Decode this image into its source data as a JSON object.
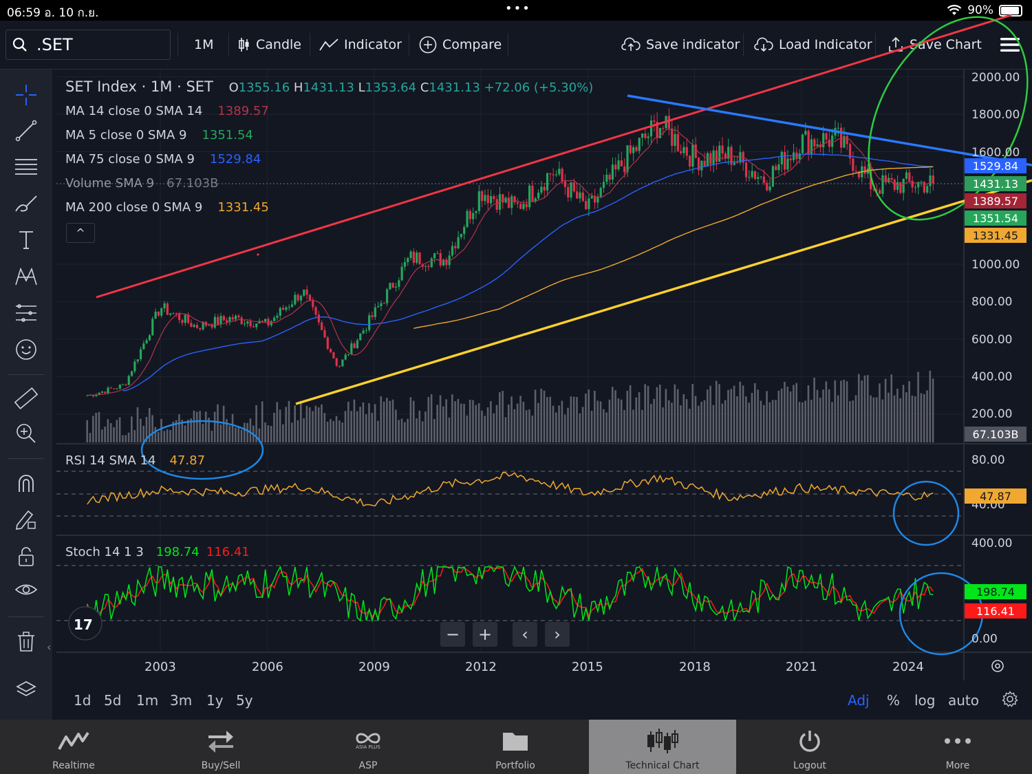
{
  "status": {
    "time": "06:59",
    "date": "อ. 10 ก.ย.",
    "dots": "•••",
    "battery": "90%"
  },
  "toolbar": {
    "symbol": ".SET",
    "interval": "1M",
    "candle": "Candle",
    "indicator": "Indicator",
    "compare": "Compare",
    "save_indicator": "Save indicator",
    "load_indicator": "Load Indicator",
    "save_chart": "Save Chart"
  },
  "legend": {
    "title": "SET Index · 1M · SET",
    "o_label": "O",
    "o": "1355.16",
    "h_label": "H",
    "h": "1431.13",
    "l_label": "L",
    "l": "1353.64",
    "c_label": "C",
    "c": "1431.13",
    "chg": "+72.06 (+5.30%)",
    "ma14_label": "MA 14 close 0 SMA 14",
    "ma14": "1389.57",
    "ma5_label": "MA 5 close 0 SMA 9",
    "ma5": "1351.54",
    "ma75_label": "MA 75 close 0 SMA 9",
    "ma75": "1529.84",
    "vol_label": "Volume SMA 9",
    "vol": "67.103B",
    "ma200_label": "MA 200 close 0 SMA 9",
    "ma200": "1331.45",
    "collapse": "^"
  },
  "rsi": {
    "label": "RSI 14 SMA 14",
    "value": "47.87",
    "axis": [
      "80.00",
      "40.00"
    ]
  },
  "stoch": {
    "label": "Stoch 14 1 3",
    "k": "198.74",
    "d": "116.41",
    "axis": [
      "400.00",
      "0.00"
    ]
  },
  "price_axis": [
    "2000.00",
    "1800.00",
    "1600.00",
    "1000.00",
    "800.00",
    "600.00",
    "400.00",
    "200.00"
  ],
  "price_tags": {
    "ma75": "1529.84",
    "close": "1431.13",
    "ma14": "1389.57",
    "ma5": "1351.54",
    "ma200": "1331.45",
    "vol": "67.103B"
  },
  "x_axis": [
    "2003",
    "2006",
    "2009",
    "2012",
    "2015",
    "2018",
    "2021",
    "2024"
  ],
  "nav": {
    "zoom_out": "−",
    "zoom_in": "+",
    "prev": "‹",
    "next": "›"
  },
  "ranges": [
    "1d",
    "5d",
    "1m",
    "3m",
    "1y",
    "5y"
  ],
  "range_opts": {
    "adj": "Adj",
    "pct": "%",
    "log": "log",
    "auto": "auto"
  },
  "tabs": [
    "Realtime",
    "Buy/Sell",
    "ASP",
    "Portfolio",
    "Technical Chart",
    "Logout",
    "More"
  ],
  "asp_logo": "ASIA PLUS",
  "colors": {
    "ma14": "#b2344a",
    "ma5": "#26a65b",
    "ma75": "#2962ff",
    "ma200": "#f0a830",
    "close_tag": "#2e9c5a",
    "ma14_tag": "#a32536",
    "rsi": "#f0a830",
    "stoch_k": "#00e61a",
    "stoch_d": "#ff1a1a"
  },
  "chart_data": [
    {
      "type": "line",
      "title": "SET Index · 1M · SET",
      "x": [
        2001,
        2002,
        2003,
        2004,
        2005,
        2006,
        2007,
        2008,
        2009,
        2010,
        2011,
        2012,
        2013,
        2014,
        2015,
        2016,
        2017,
        2018,
        2019,
        2020,
        2021,
        2022,
        2023,
        2024
      ],
      "series": [
        {
          "name": "SET Index",
          "values": [
            300,
            356,
            772,
            668,
            713,
            679,
            858,
            450,
            735,
            1033,
            1025,
            1392,
            1299,
            1498,
            1288,
            1543,
            1753,
            1564,
            1580,
            1449,
            1657,
            1669,
            1416,
            1431
          ]
        }
      ],
      "ylim": [
        0,
        2000
      ]
    },
    {
      "type": "line",
      "x": [
        2001,
        2003,
        2005,
        2007,
        2009,
        2011,
        2013,
        2015,
        2017,
        2019,
        2021,
        2023,
        2024
      ],
      "series": [
        {
          "name": "RSI 14 SMA 14",
          "values": [
            42,
            55,
            52,
            60,
            35,
            62,
            75,
            50,
            72,
            45,
            58,
            52,
            47.87
          ]
        }
      ],
      "ylim": [
        0,
        100
      ]
    },
    {
      "type": "line",
      "x": [
        2001,
        2003,
        2005,
        2007,
        2009,
        2011,
        2013,
        2015,
        2017,
        2019,
        2021,
        2023,
        2024
      ],
      "series": [
        {
          "name": "Stoch 14 1 3",
          "values": [
            50,
            300,
            250,
            320,
            0,
            380,
            380,
            50,
            380,
            20,
            380,
            20,
            198.74
          ]
        }
      ],
      "ylim": [
        0,
        400
      ]
    }
  ]
}
